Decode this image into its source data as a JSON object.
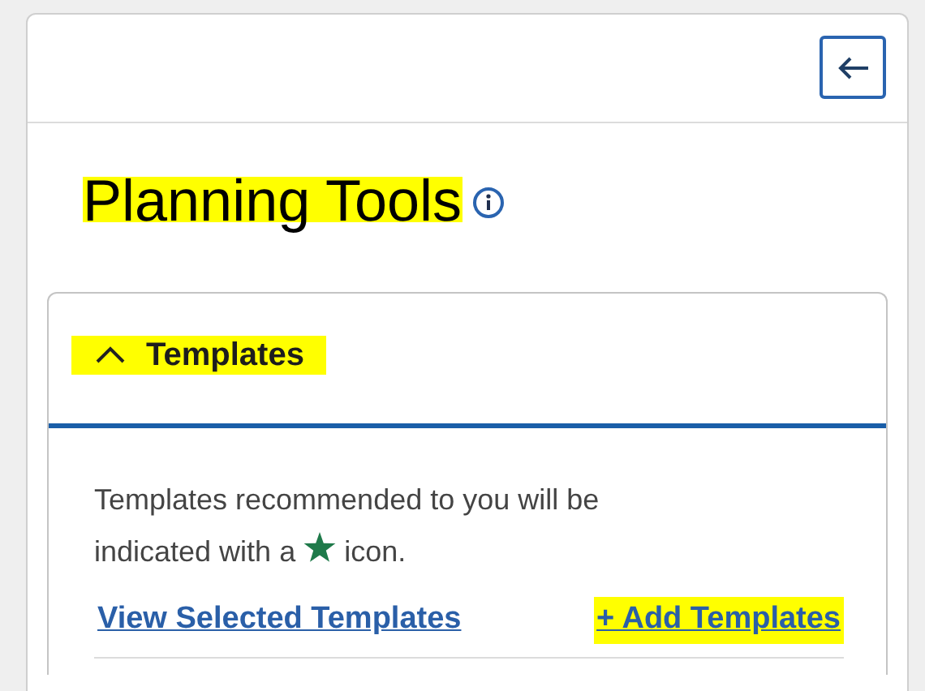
{
  "title": {
    "text": "Planning Tools",
    "highlighted": true
  },
  "section": {
    "title": "Templates",
    "expanded": true,
    "highlighted": true,
    "description_line_1": "Templates recommended to you will be",
    "description_before_icon": "indicated with a",
    "description_after_icon": "icon.",
    "links": [
      {
        "label": "View Selected Templates",
        "highlighted": false
      },
      {
        "label": "+ Add Templates",
        "highlighted": true
      }
    ]
  }
}
